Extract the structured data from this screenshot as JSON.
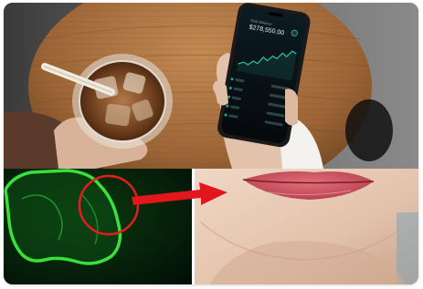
{
  "phone": {
    "balance": "$278,550.00"
  }
}
